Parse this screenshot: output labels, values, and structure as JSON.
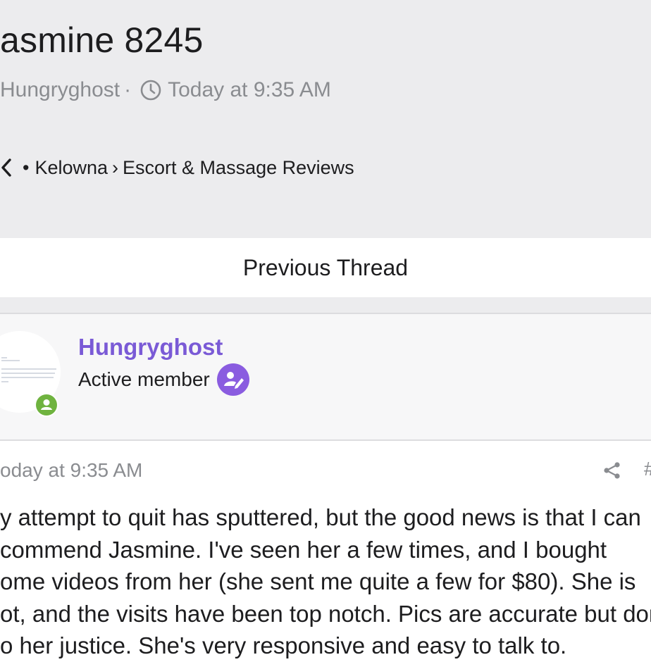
{
  "thread": {
    "title": "asmine 8245",
    "author": "Hungryghost",
    "separator": "·",
    "timestamp": "Today at 9:35 AM"
  },
  "breadcrumb": {
    "bullet": "•",
    "items": [
      "Kelowna",
      "Escort & Massage Reviews"
    ],
    "separator": "›"
  },
  "nav": {
    "previous_thread": "Previous Thread"
  },
  "post": {
    "username": "Hungryghost",
    "role": "Active member",
    "date": "oday at 9:35 AM",
    "post_number": "#",
    "body_lines": [
      "y attempt to quit has sputtered, but the good news is that I can",
      "commend Jasmine. I've seen her a few times, and I bought",
      "ome videos from her (she sent me quite a few for $80). She is",
      "ot, and the visits have been top notch. Pics are accurate but don",
      "o her justice. She's very responsive and easy to talk to."
    ]
  },
  "colors": {
    "header_bg": "#ececee",
    "username": "#7a5ad6",
    "badge": "#8a5ce0",
    "online": "#6fb33f",
    "muted_text": "#8a8c90"
  },
  "icons": [
    "clock-icon",
    "back-chevron-icon",
    "user-online-icon",
    "member-badge-icon",
    "share-icon"
  ]
}
